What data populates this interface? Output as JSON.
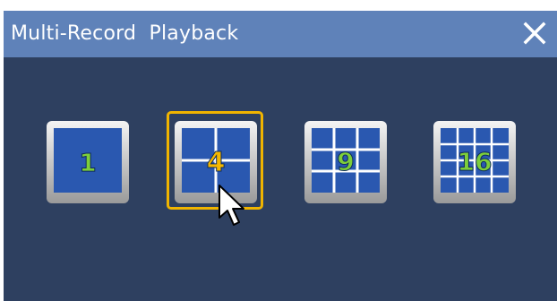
{
  "window": {
    "title": "Multi-Record  Playback",
    "close_icon": "close-icon"
  },
  "layouts": [
    {
      "label": "1",
      "icon": "single-view-icon",
      "color": "#7dce3a"
    },
    {
      "label": "4",
      "icon": "quad-view-icon",
      "color": "#f5b800",
      "selected": true
    },
    {
      "label": "9",
      "icon": "nine-view-icon",
      "color": "#7dce3a"
    },
    {
      "label": "16",
      "icon": "sixteen-view-icon",
      "color": "#7dce3a"
    }
  ],
  "colors": {
    "titlebar": "#5f82b9",
    "body": "#2e4060",
    "tile_blue": "#2a58b0",
    "selection": "#f0b400"
  },
  "cursor_icon": "mouse-pointer-icon"
}
